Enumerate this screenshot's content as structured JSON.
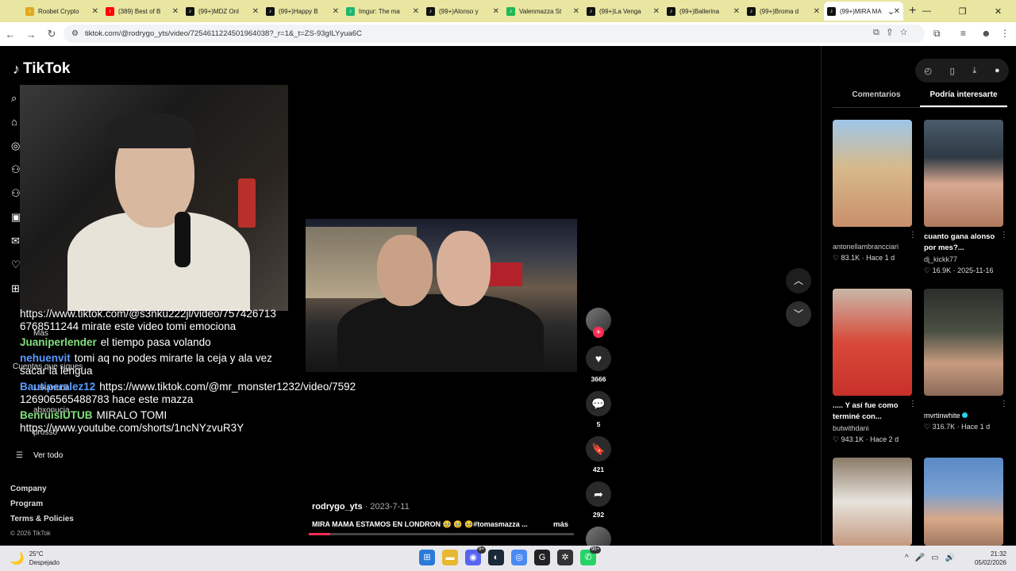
{
  "browser": {
    "tabs": [
      {
        "label": "Roobet Crypto",
        "color": "#e0a81c",
        "active": false
      },
      {
        "label": "(389) Best of B",
        "color": "#ff0000",
        "active": false
      },
      {
        "label": "(99+)MDZ Onl",
        "color": "#111111",
        "active": false
      },
      {
        "label": "(99+)Happy B",
        "color": "#111111",
        "active": false
      },
      {
        "label": "Imgur: The ma",
        "color": "#1bb76e",
        "active": false
      },
      {
        "label": "(99+)Alonso y",
        "color": "#111111",
        "active": false
      },
      {
        "label": "Valenmazza St",
        "color": "#1db954",
        "active": false
      },
      {
        "label": "(99+)La Venga",
        "color": "#111111",
        "active": false
      },
      {
        "label": "(99+)Ballerina",
        "color": "#111111",
        "active": false
      },
      {
        "label": "(99+)Broma d",
        "color": "#111111",
        "active": false
      },
      {
        "label": "(99+)MIRA MA",
        "color": "#111111",
        "active": true
      }
    ],
    "url": "tiktok.com/@rodrygo_yts/video/7254611224501964038?_r=1&_t=ZS-93gILYyua6C"
  },
  "tiktok": {
    "logo": "TikTok",
    "footer": {
      "company": "Company",
      "program": "Program",
      "terms": "Terms & Policies",
      "copyright": "© 2026 TikTok"
    },
    "behind": {
      "mas": "Más",
      "cuentas": "Cuentas que sigues",
      "ver_todo": "Ver todo",
      "following1": "Lakawuda",
      "following2": "abxonucia",
      "following3": "prosso"
    }
  },
  "chat": [
    {
      "user": "",
      "text": "https://www.tiktok.com/@s3nku222jl/video/757426713 6768511244 mirate este video tomi emociona",
      "color": "green"
    },
    {
      "user": "Juaniperlender",
      "text": "el tiempo pasa volando",
      "color": "green"
    },
    {
      "user": "nehuenvit",
      "text": "tomi aq no podes mirarte la ceja y ala vez sacar la lengua",
      "color": "blue"
    },
    {
      "user": "Bautiperalez12",
      "text": "https://www.tiktok.com/@mr_monster1232/video/7592 126906565488783 hace este mazza",
      "color": "blue"
    },
    {
      "user": "BenruisIUTUB",
      "text": "MIRALO TOMI https://www.youtube.com/shorts/1ncNYzvuR3Y",
      "color": "green"
    }
  ],
  "video": {
    "author": "rodrygo_yts",
    "date": "· 2023-7-11",
    "caption": "MIRA MAMA ESTAMOS EN LONDRON 🥹 🥹 🥹#tomasmazza ...",
    "more": "más",
    "progress": 0.08,
    "likes": "3666",
    "comments": "5",
    "saves": "421",
    "shares": "292"
  },
  "right_panel": {
    "tabs": [
      "Comentarios",
      "Podría interesarte"
    ],
    "cards": [
      {
        "title": "",
        "user": "antonellambrancciari",
        "likes": "83.1K",
        "when": "Hace 1 d",
        "verified": false
      },
      {
        "title": "cuanto gana alonso por mes?...",
        "user": "dj_kickk77",
        "likes": "16.9K",
        "when": "2025-11-16",
        "verified": false
      },
      {
        "title": "..... Y así fue como terminé con...",
        "user": "butwithdani",
        "likes": "943.1K",
        "when": "Hace 2 d",
        "verified": false
      },
      {
        "title": "",
        "user": "mvrtinwhite",
        "likes": "316.7K",
        "when": "Hace 1 d",
        "verified": true
      }
    ]
  },
  "taskbar": {
    "temp": "25°C",
    "weather": "Despejado",
    "time": "21:32",
    "date": "05/02/2026"
  }
}
